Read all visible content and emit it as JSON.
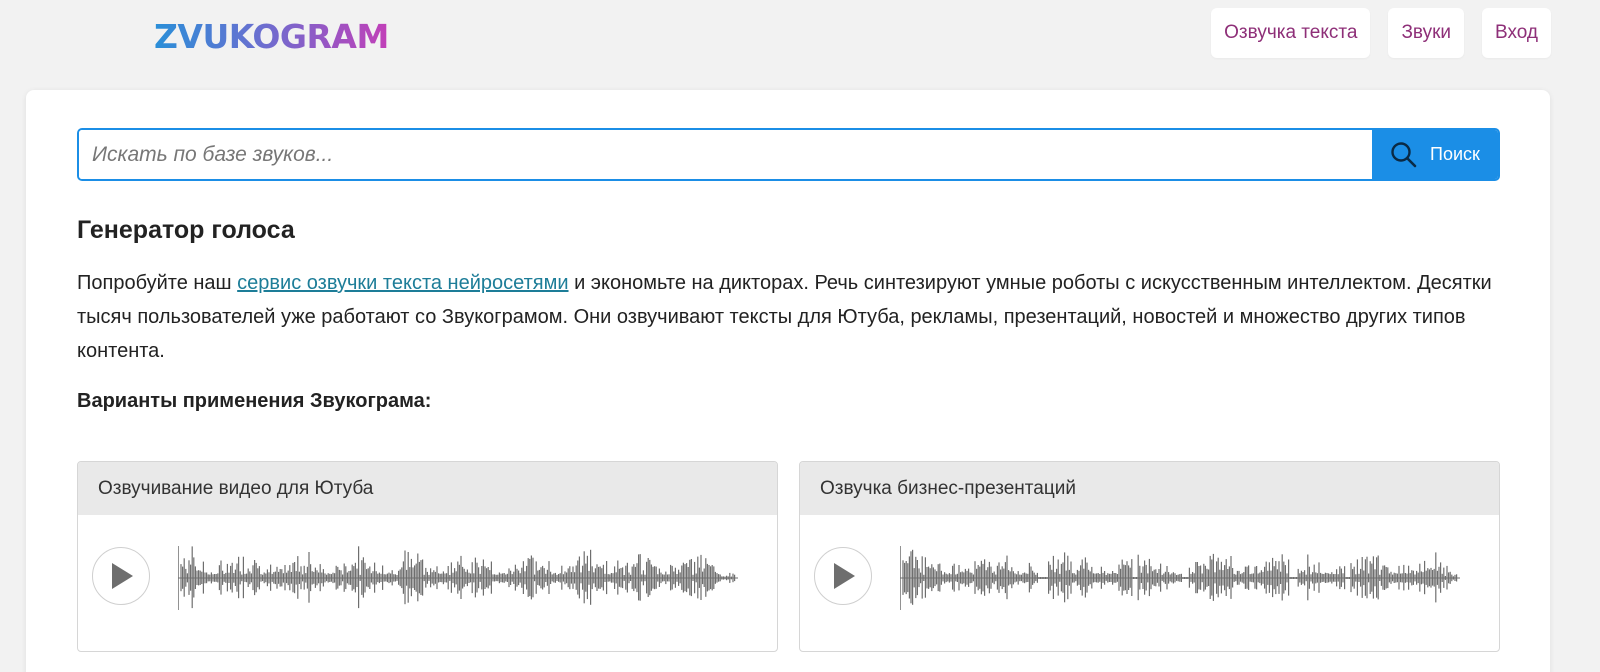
{
  "header": {
    "logo_text": "ZVUKOGRAM",
    "nav": [
      {
        "label": "Озвучка текста"
      },
      {
        "label": "Звуки"
      },
      {
        "label": "Вход"
      }
    ]
  },
  "search": {
    "placeholder": "Искать по базе звуков...",
    "button_label": "Поиск",
    "icon": "search-icon"
  },
  "content": {
    "title": "Генератор голоса",
    "para_prefix": "Попробуйте наш ",
    "para_link": "сервис озвучки текста нейросетями",
    "para_suffix": " и экономьте на дикторах. Речь синтезируют умные роботы с искусственным интеллектом. Десятки тысяч пользователей уже работают со Звукограмом. Они озвучивают тексты для Ютуба, рекламы, презентаций, новостей и множество других типов контента.",
    "subtitle": "Варианты применения Звукограма:"
  },
  "samples": [
    {
      "title": "Озвучивание видео для Ютуба",
      "icon": "play-icon"
    },
    {
      "title": "Озвучка бизнес-презентаций",
      "icon": "play-icon"
    }
  ],
  "colors": {
    "accent": "#1b8ee6",
    "nav_text": "#8e2f78",
    "link": "#1d7d98",
    "waveform": "#6e6e6e"
  }
}
